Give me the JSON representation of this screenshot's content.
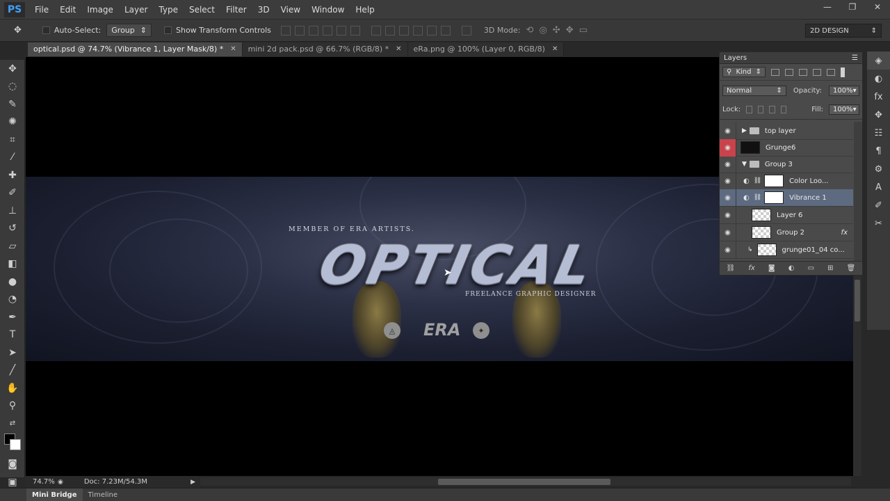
{
  "app": {
    "logo": "PS"
  },
  "menu": [
    "File",
    "Edit",
    "Image",
    "Layer",
    "Type",
    "Select",
    "Filter",
    "3D",
    "View",
    "Window",
    "Help"
  ],
  "window_controls": [
    "—",
    "❐",
    "✕"
  ],
  "options": {
    "auto_select_label": "Auto-Select:",
    "auto_select_target": "Group",
    "transform_controls_label": "Show Transform Controls",
    "mode3d_label": "3D Mode:",
    "workspace": "2D DESIGN"
  },
  "tabs": [
    {
      "label": "optical.psd @ 74.7% (Vibrance 1, Layer Mask/8) *",
      "active": true
    },
    {
      "label": "mini 2d pack.psd @ 66.7% (RGB/8) *",
      "active": false
    },
    {
      "label": "eRa.png @ 100% (Layer 0, RGB/8)",
      "active": false
    }
  ],
  "tab_close": "✕",
  "canvas": {
    "member_text": "MEMBER OF ERA ARTISTS.",
    "title": "OPTICAL",
    "freelance_text": "FREELANCE GRAPHIC DESIGNER",
    "era_logo": "ERA"
  },
  "status": {
    "zoom": "74.7%",
    "doc": "Doc: 7.23M/54.3M",
    "arrow": "▶"
  },
  "bottom_tabs": [
    "Mini Bridge",
    "Timeline"
  ],
  "layers": {
    "title": "Layers",
    "filter_kind": "Kind",
    "blend_mode": "Normal",
    "opacity_label": "Opacity:",
    "opacity_value": "100%",
    "lock_label": "Lock:",
    "fill_label": "Fill:",
    "fill_value": "100%",
    "fx_label": "fx",
    "items": [
      {
        "name": "top layer",
        "kind": "group",
        "visible": true
      },
      {
        "name": "Grunge6",
        "kind": "layer",
        "thumb": "black",
        "visible": true,
        "eye_red": true
      },
      {
        "name": "Group 3",
        "kind": "group-open",
        "visible": true
      },
      {
        "name": "Color Loo...",
        "kind": "adjustment",
        "thumb": "white",
        "visible": true
      },
      {
        "name": "Vibrance 1",
        "kind": "adjustment",
        "thumb": "white",
        "visible": true,
        "selected": true
      },
      {
        "name": "Layer 6",
        "kind": "layer",
        "thumb": "check",
        "visible": true
      },
      {
        "name": "Group 2",
        "kind": "smart",
        "thumb": "check",
        "visible": true,
        "fx": true
      },
      {
        "name": "grunge01_04 co...",
        "kind": "layer",
        "thumb": "check",
        "visible": true
      }
    ]
  }
}
